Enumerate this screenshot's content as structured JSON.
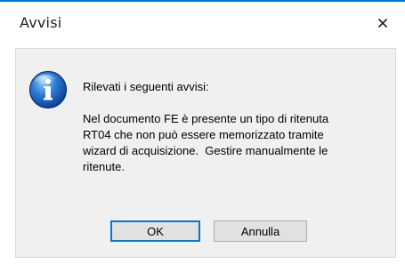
{
  "dialog": {
    "title": "Avvisi",
    "close_icon": "close-icon",
    "icon": "info-icon",
    "heading": "Rilevati i seguenti avvisi:",
    "message_lines": [
      "Nel documento FE è presente un tipo di ritenuta",
      "RT04 che non può essere memorizzato tramite",
      "wizard di acquisizione.  Gestire manualmente le",
      "ritenute."
    ],
    "ok_label": "OK",
    "cancel_label": "Annulla"
  },
  "colors": {
    "accent": "#0078d7",
    "content_background": "#f0f0f0",
    "button_face": "#e1e1e1"
  }
}
